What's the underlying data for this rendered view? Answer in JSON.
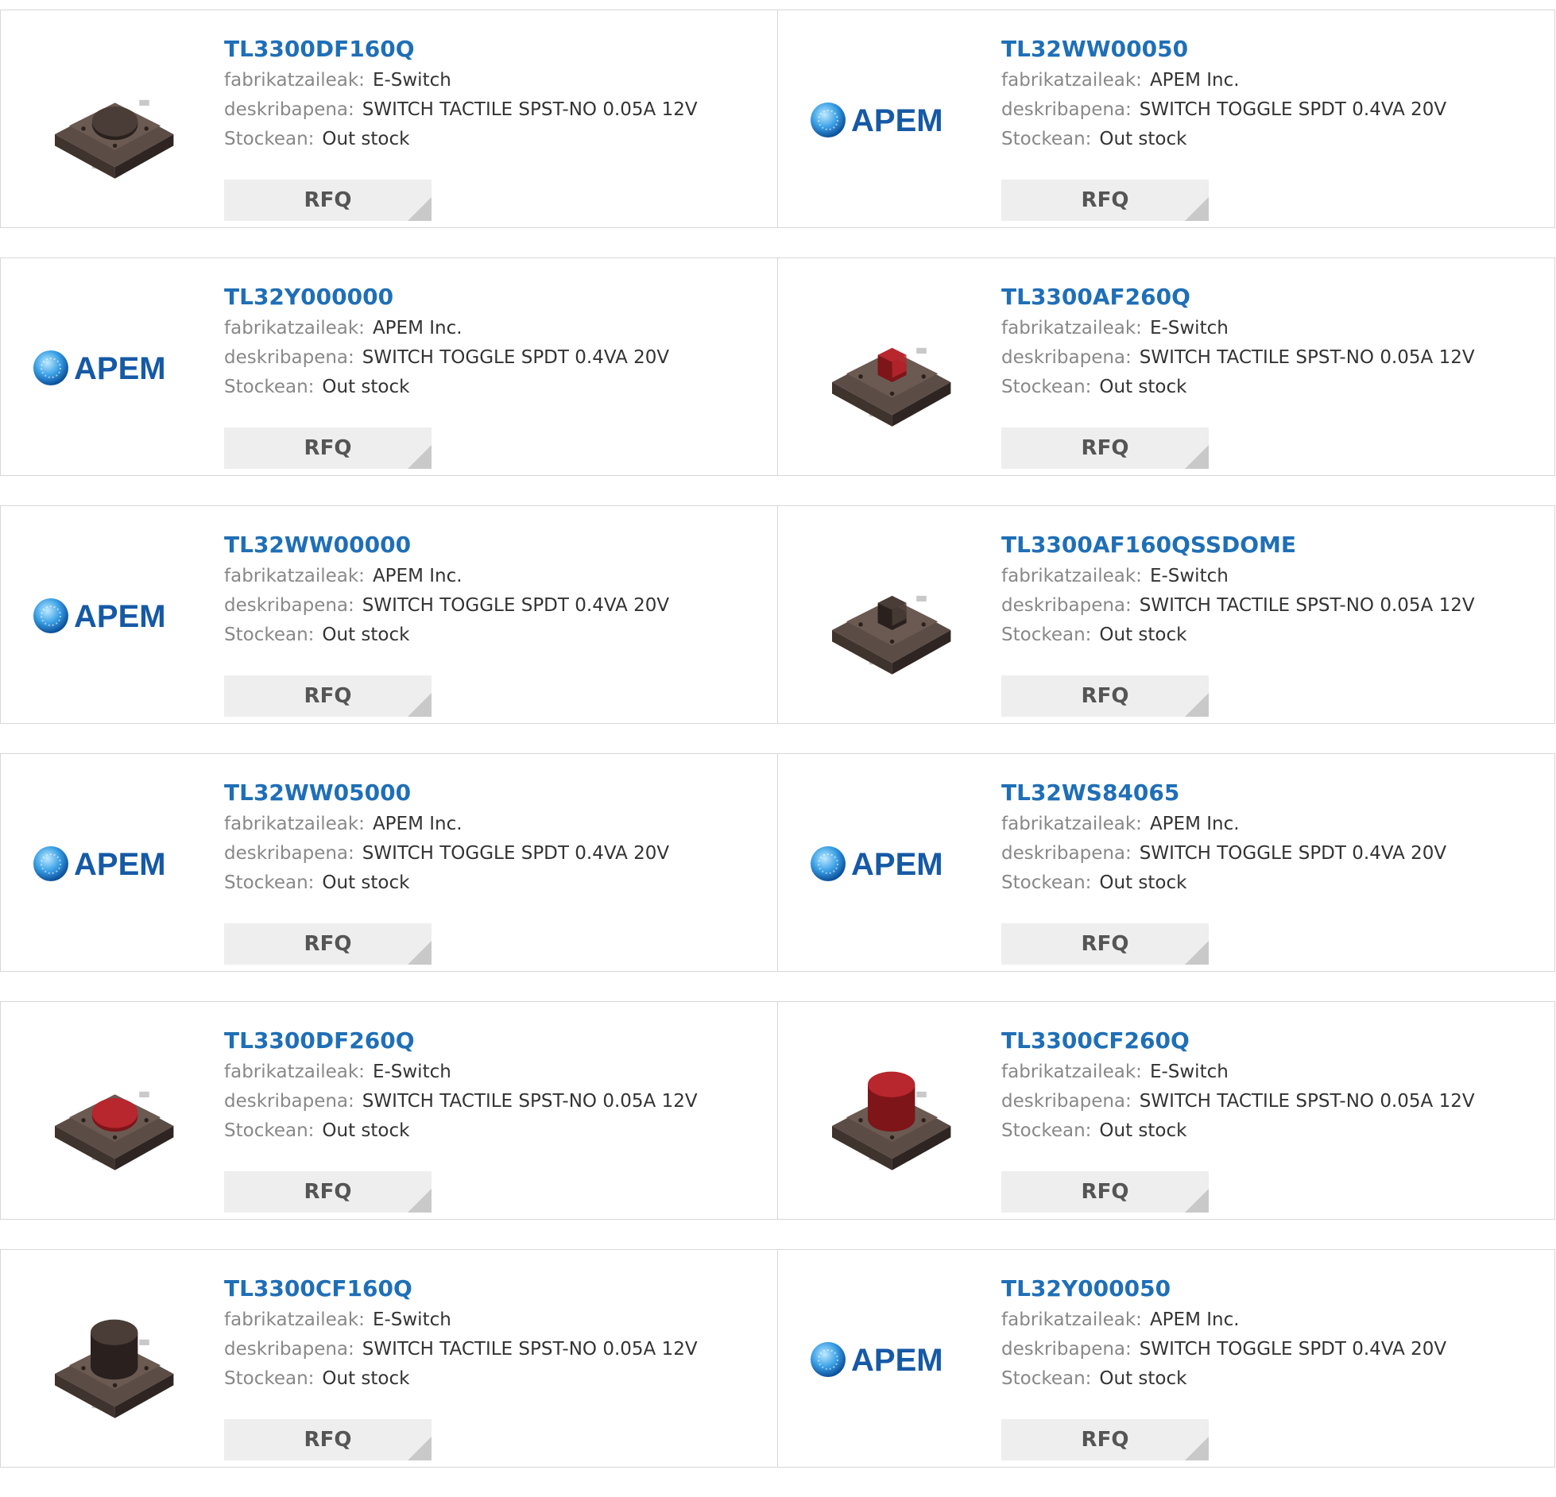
{
  "labels": {
    "manufacturer": "fabrikatzaileak:",
    "description": "deskribapena:",
    "stock": "Stockean:",
    "rfq": "RFQ"
  },
  "brand": {
    "apem_text": "APEM",
    "apem_color": "#1659a6"
  },
  "colors": {
    "part_number_link": "#1f6fb7",
    "label_gray": "#888888",
    "rfq_bg": "#eeeeee"
  },
  "products": [
    {
      "part_number": "TL3300DF160Q",
      "manufacturer": "E-Switch",
      "description": "SWITCH TACTILE SPST-NO 0.05A 12V",
      "stock": "Out stock",
      "image": "tactile-switch-flat-dark-cap"
    },
    {
      "part_number": "TL32WW00050",
      "manufacturer": "APEM Inc.",
      "description": "SWITCH TOGGLE SPDT 0.4VA 20V",
      "stock": "Out stock",
      "image": "apem-logo"
    },
    {
      "part_number": "TL32Y000000",
      "manufacturer": "APEM Inc.",
      "description": "SWITCH TOGGLE SPDT 0.4VA 20V",
      "stock": "Out stock",
      "image": "apem-logo"
    },
    {
      "part_number": "TL3300AF260Q",
      "manufacturer": "E-Switch",
      "description": "SWITCH TACTILE SPST-NO 0.05A 12V",
      "stock": "Out stock",
      "image": "tactile-switch-square-red-stem"
    },
    {
      "part_number": "TL32WW00000",
      "manufacturer": "APEM Inc.",
      "description": "SWITCH TOGGLE SPDT 0.4VA 20V",
      "stock": "Out stock",
      "image": "apem-logo"
    },
    {
      "part_number": "TL3300AF160QSSDOME",
      "manufacturer": "E-Switch",
      "description": "SWITCH TACTILE SPST-NO 0.05A 12V",
      "stock": "Out stock",
      "image": "tactile-switch-square-dark-stem"
    },
    {
      "part_number": "TL32WW05000",
      "manufacturer": "APEM Inc.",
      "description": "SWITCH TOGGLE SPDT 0.4VA 20V",
      "stock": "Out stock",
      "image": "apem-logo"
    },
    {
      "part_number": "TL32WS84065",
      "manufacturer": "APEM Inc.",
      "description": "SWITCH TOGGLE SPDT 0.4VA 20V",
      "stock": "Out stock",
      "image": "apem-logo"
    },
    {
      "part_number": "TL3300DF260Q",
      "manufacturer": "E-Switch",
      "description": "SWITCH TACTILE SPST-NO 0.05A 12V",
      "stock": "Out stock",
      "image": "tactile-switch-flat-red-cap"
    },
    {
      "part_number": "TL3300CF260Q",
      "manufacturer": "E-Switch",
      "description": "SWITCH TACTILE SPST-NO 0.05A 12V",
      "stock": "Out stock",
      "image": "tactile-switch-tall-red-cap"
    },
    {
      "part_number": "TL3300CF160Q",
      "manufacturer": "E-Switch",
      "description": "SWITCH TACTILE SPST-NO 0.05A 12V",
      "stock": "Out stock",
      "image": "tactile-switch-tall-dark-cap"
    },
    {
      "part_number": "TL32Y000050",
      "manufacturer": "APEM Inc.",
      "description": "SWITCH TOGGLE SPDT 0.4VA 20V",
      "stock": "Out stock",
      "image": "apem-logo"
    }
  ]
}
